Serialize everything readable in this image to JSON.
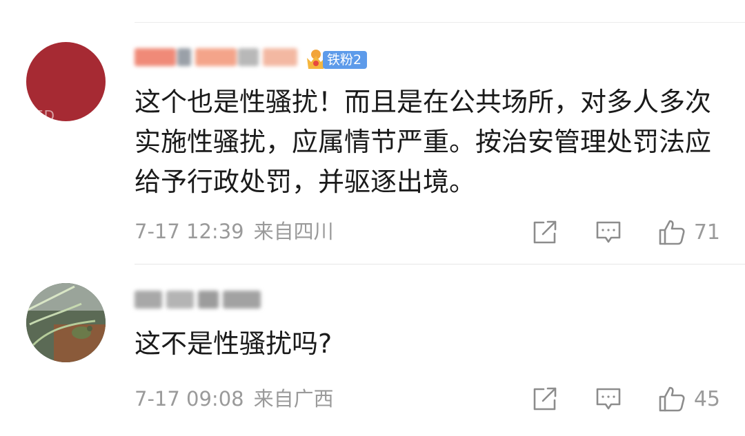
{
  "comments": [
    {
      "badge": "铁粉2",
      "avatar_text": "ED",
      "text": "这个也是性骚扰！而且是在公共场所，对多人多次实施性骚扰，应属情节严重。按治安管理处罚法应给予行政处罚，并驱逐出境。",
      "time": "7-17 12:39",
      "location": "来自四川",
      "likes": "71"
    },
    {
      "text": "这不是性骚扰吗?",
      "time": "7-17 09:08",
      "location": "来自广西",
      "likes": "45"
    }
  ],
  "icons": {
    "share": "share-icon",
    "reply": "comment-icon",
    "like": "thumbs-up-icon"
  },
  "colors": {
    "text": "#1a1a1a",
    "meta": "#9a9a9a",
    "badge": "#5d9bea",
    "avatar1": "#a62a33"
  }
}
